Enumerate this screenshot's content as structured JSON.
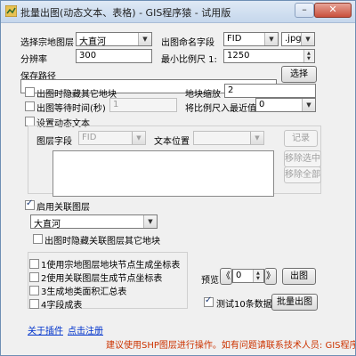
{
  "window": {
    "title": "批量出图(动态文本、表格) - GIS程序猿 - 试用版",
    "minimize_glyph": "–",
    "close_glyph": "✕"
  },
  "form": {
    "layer_label": "选择宗地图层",
    "layer_value": "大直河",
    "name_field_label": "出图命名字段",
    "name_field_value": "FID",
    "format_value": ".jpg",
    "dpi_label": "分辨率",
    "dpi_value": "300",
    "min_scale_label": "最小比例尺 1:",
    "min_scale_value": "1250",
    "save_path_label": "保存路径",
    "save_path_value": "",
    "browse_label": "选择",
    "hide_other_label": "出图时隐藏其它地块",
    "zoom_label": "地块缩放",
    "zoom_value": "2",
    "wait_label": "出图等待时间(秒)",
    "wait_value": "1",
    "round_label": "将比例尺入最近值",
    "round_value": "0"
  },
  "dynamic_text": {
    "checkbox_label": "设置动态文本",
    "layer_field_label": "图层字段",
    "layer_field_value": "FID",
    "text_position_label": "文本位置",
    "text_position_value": "",
    "record_label": "记录",
    "remove_selected_label": "移除选中",
    "remove_all_label": "移除全部"
  },
  "related_layers": {
    "checkbox_label": "启用关联图层",
    "layer_value": "大直河",
    "hide_other_label": "出图时隐藏关联图层其它地块"
  },
  "options": [
    "1使用宗地图层地块节点生成坐标表",
    "2使用关联图层生成节点坐标表",
    "3生成地类面积汇总表",
    "4字段成表"
  ],
  "preview": {
    "label": "预览",
    "prev_glyph": "《",
    "next_glyph": "》",
    "index_value": "0",
    "export_label": "出图"
  },
  "batch": {
    "test_label": "测试10条数据",
    "batch_label": "批量出图"
  },
  "footer": {
    "about_link": "关于插件",
    "register_link": "点击注册",
    "notice": "建议使用SHP图层进行操作。如有问题请联系技术人员: GIS程序"
  }
}
